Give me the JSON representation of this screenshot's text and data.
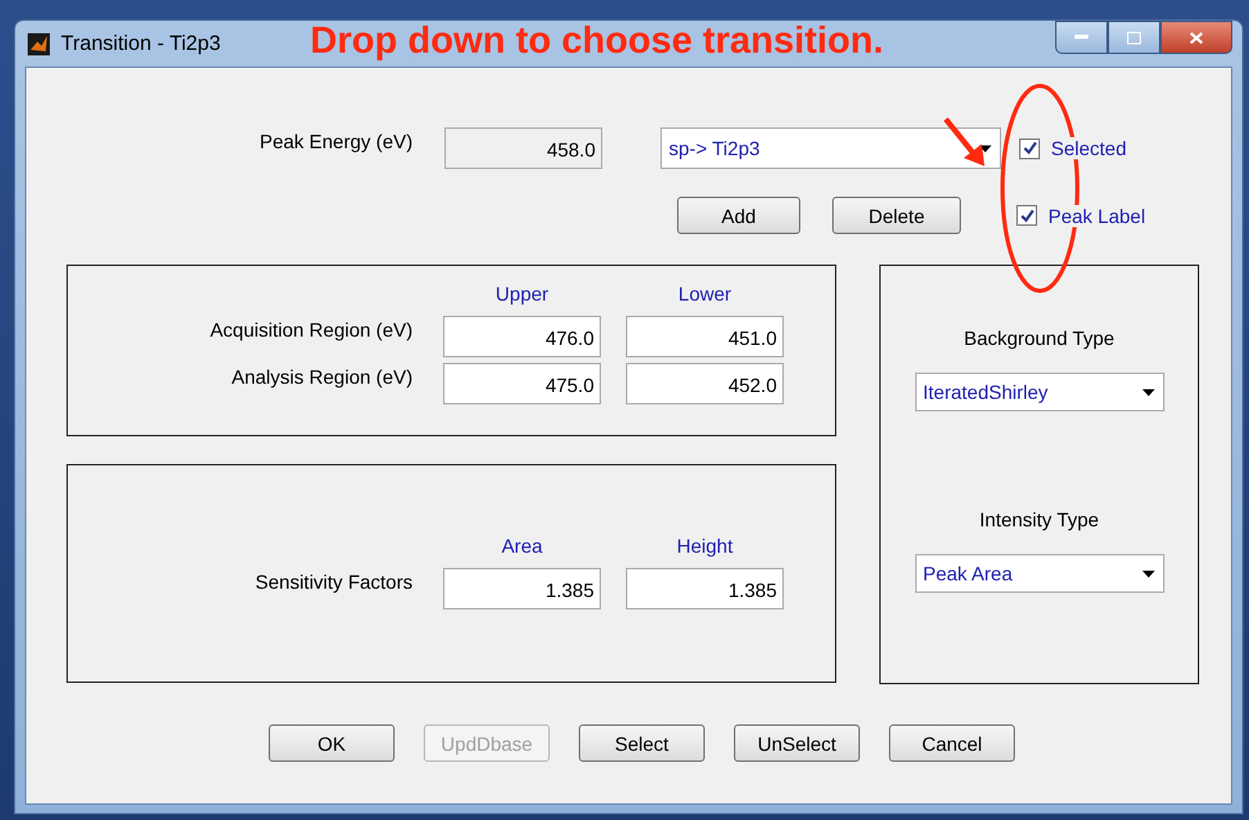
{
  "window": {
    "title": "Transition - Ti2p3"
  },
  "annotation": {
    "text": "Drop down to choose transition."
  },
  "peak_energy": {
    "label": "Peak Energy (eV)",
    "value": "458.0",
    "disabled": true
  },
  "transition_dropdown": {
    "value": "sp-> Ti2p3"
  },
  "checkboxes": [
    {
      "label": "Selected",
      "checked": true
    },
    {
      "label": "Peak Label",
      "checked": true
    }
  ],
  "actions": [
    "Add",
    "Delete"
  ],
  "regions": {
    "columns": [
      "Upper",
      "Lower"
    ],
    "rows": [
      {
        "label": "Acquisition Region (eV)",
        "values": [
          "476.0",
          "451.0"
        ]
      },
      {
        "label": "Analysis Region (eV)",
        "values": [
          "475.0",
          "452.0"
        ]
      }
    ]
  },
  "sensitivity": {
    "columns": [
      "Area",
      "Height"
    ],
    "label": "Sensitivity Factors",
    "values": [
      "1.385",
      "1.385"
    ]
  },
  "background_type": {
    "label": "Background Type",
    "value": "IteratedShirley"
  },
  "intensity_type": {
    "label": "Intensity Type",
    "value": "Peak Area"
  },
  "buttons": [
    {
      "label": "OK",
      "disabled": false
    },
    {
      "label": "UpdDbase",
      "disabled": true
    },
    {
      "label": "Select",
      "disabled": false
    },
    {
      "label": "UnSelect",
      "disabled": false
    },
    {
      "label": "Cancel",
      "disabled": false
    }
  ]
}
